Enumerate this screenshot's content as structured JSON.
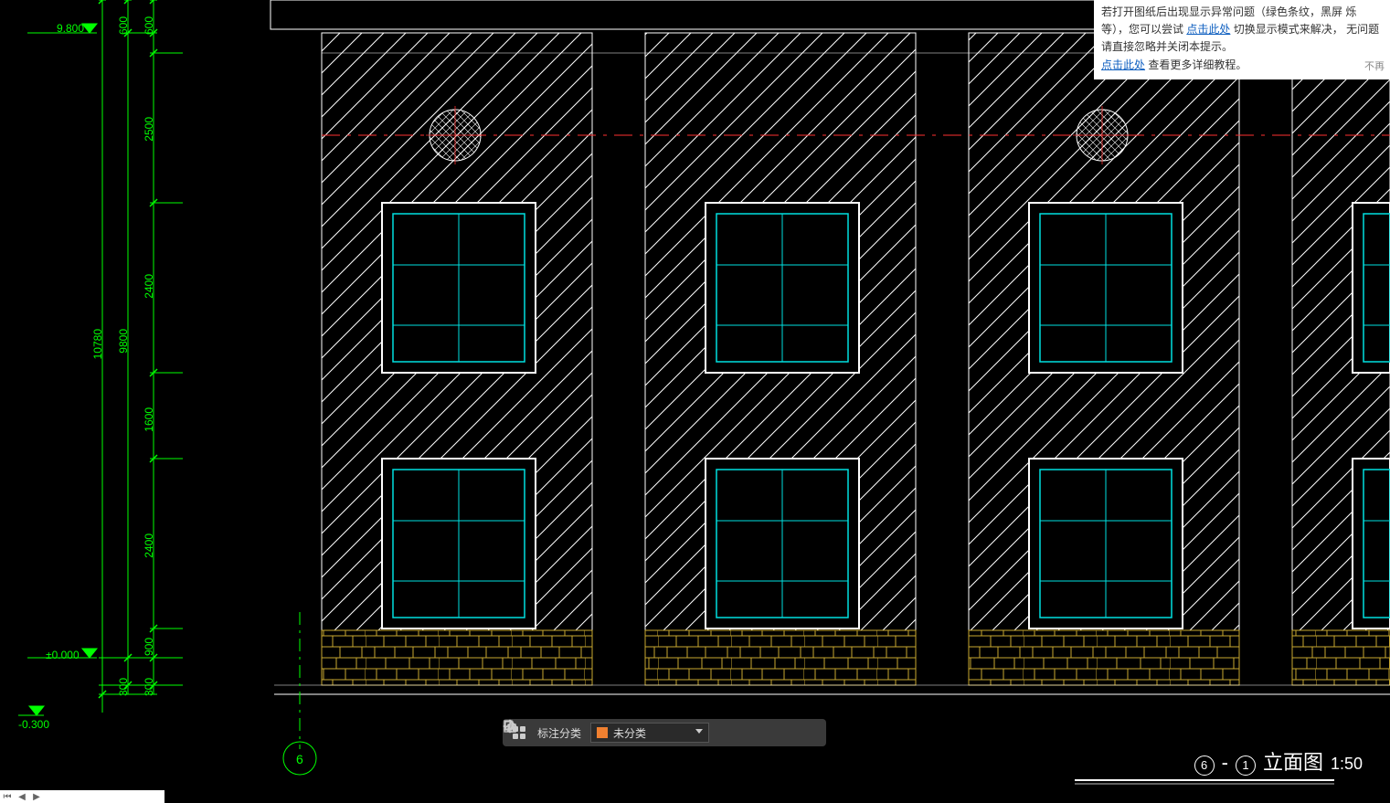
{
  "notice": {
    "line1a": "若打开图纸后出现显示异常问题（绿色条纹，黑屏",
    "line1b": "烁等），您可以尝试",
    "link1": "点击此处",
    "line1c": "切换显示模式来解决，",
    "line2": "无问题请直接忽略并关闭本提示。",
    "link2": "点击此处",
    "line3": "查看更多详细教程。",
    "dismiss": "不再"
  },
  "toolbar": {
    "label": "标注分类",
    "select_value": "未分类"
  },
  "title": {
    "num_a": "6",
    "num_b": "1",
    "text": "立面图",
    "scale": "1:50"
  },
  "dims": {
    "d9800": "9.800",
    "d10780": "10780",
    "d600a": "600",
    "d600b": "600",
    "d2500": "2500",
    "d2400a": "2400",
    "d9800b": "9800",
    "d1600": "1600",
    "d2400b": "2400",
    "d900": "900",
    "d300a": "300",
    "d300b": "300",
    "d_pm0": "±0.000",
    "d_m03": "-0.300",
    "axis6": "6"
  }
}
